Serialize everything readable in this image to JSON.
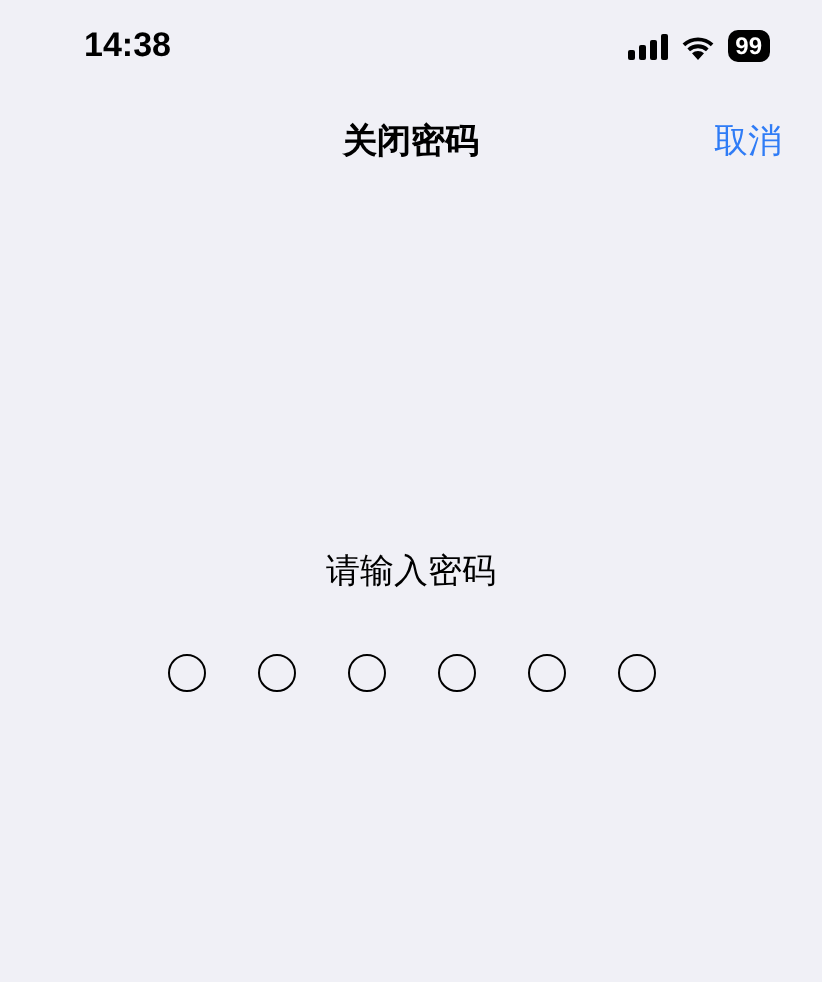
{
  "status_bar": {
    "time": "14:38",
    "battery": "99"
  },
  "nav": {
    "title": "关闭密码",
    "cancel": "取消"
  },
  "prompt": "请输入密码",
  "passcode_dots": [
    {
      "filled": false
    },
    {
      "filled": false
    },
    {
      "filled": false
    },
    {
      "filled": false
    },
    {
      "filled": false
    },
    {
      "filled": false
    }
  ]
}
